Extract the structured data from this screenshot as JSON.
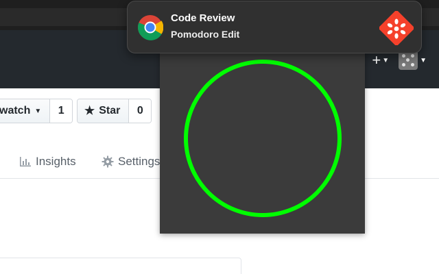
{
  "colors": {
    "chrome_bg": "#1f1f1f",
    "github_header_bg": "#24292e",
    "popup_bg": "#3b3b3b",
    "timer_ring": "#00ff00",
    "notification_bg": "#303030",
    "content_icon_bg": "#f5412b"
  },
  "github": {
    "header": {
      "new_menu_label": "+",
      "new_menu_icon": "chevron-down-icon",
      "avatar_icon": "avatar-dice"
    },
    "repo_toolbar": {
      "watch_label": "watch",
      "watch_count": "1",
      "star_label": "Star",
      "star_count": "0"
    },
    "tabs": [
      {
        "label": "Insights",
        "icon": "graph-icon"
      },
      {
        "label": "Settings",
        "icon": "gear-icon"
      }
    ]
  },
  "extension_popup": {
    "timer_progress": 1.0
  },
  "notification": {
    "app_icon": "chrome-icon",
    "title": "Code Review",
    "subtitle": "Pomodoro Edit",
    "content_icon": "tomato-flower-icon"
  }
}
